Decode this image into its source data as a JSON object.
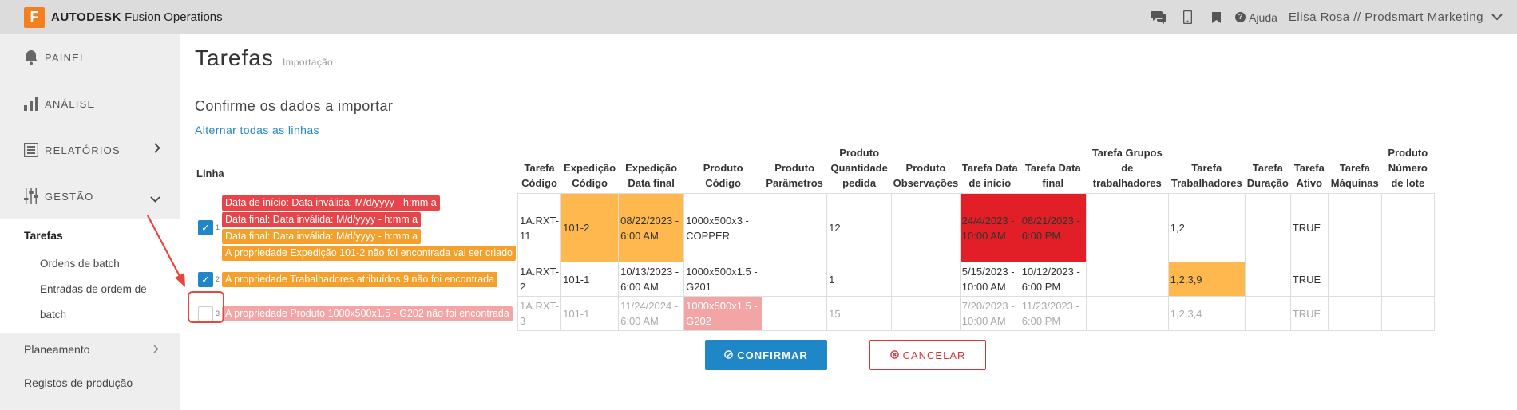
{
  "topbar": {
    "logo_letter": "F",
    "brand_bold": "AUTODESK",
    "brand_rest": "Fusion Operations",
    "help_label": "Ajuda",
    "user_label": "Elisa Rosa // Prodsmart Marketing",
    "icons": [
      "chat-icon",
      "mobile-icon",
      "bookmark-icon",
      "question-icon",
      "chevron-down-icon"
    ]
  },
  "sidebar": {
    "painel": "PAINEL",
    "analise": "ANÁLISE",
    "relatorios": "RELATÓRIOS",
    "gestao": "GESTÃO",
    "tarefas": "Tarefas",
    "ordens": "Ordens de batch",
    "entradas": "Entradas de ordem de batch",
    "planeamento": "Planeamento",
    "registos": "Registos de produção"
  },
  "page": {
    "title": "Tarefas",
    "subtitle": "Importação",
    "confirm_heading": "Confirme os dados a importar",
    "toggle_all": "Alternar todas as linhas"
  },
  "table": {
    "headers": {
      "linha": "Linha",
      "h1": "Tarefa Código",
      "h2": "Expedição Código",
      "h3": "Expedição Data final",
      "h4": "Produto Código",
      "h5": "Produto Parâmetros",
      "h6": "Produto Quantidade pedida",
      "h7": "Produto Observações",
      "h8": "Tarefa Data de início",
      "h9": "Tarefa Data final",
      "h10": "Tarefa Grupos de trabalhadores",
      "h11": "Tarefa Trabalhadores",
      "h12": "Tarefa Duração",
      "h13": "Tarefa Ativo",
      "h14": "Tarefa Máquinas",
      "h15": "Produto Número de lote"
    },
    "rows": [
      {
        "num": "1",
        "checked": true,
        "errors": [
          "Data de início: Data inválida: M/d/yyyy - h:mm a",
          "Data final: Data inválida: M/d/yyyy - h:mm a",
          "Data final: Data inválida: M/d/yyyy - h:mm a",
          "A propriedade Expedição 101-2 não foi encontrada vai ser criado"
        ],
        "c1": "1A.RXT-11",
        "c2": "101-2",
        "c3": "08/22/2023 - 6:00 AM",
        "c4": "1000x500x3 - COPPER",
        "c5": "",
        "c6": "12",
        "c7": "",
        "c8": "24/4/2023 - 10:00 AM",
        "c9": "08/21/2023 - 6:00 PM",
        "c10": "",
        "c11": "1,2",
        "c12": "",
        "c13": "TRUE",
        "c14": "",
        "c15": ""
      },
      {
        "num": "2",
        "checked": true,
        "errors": [
          "A propriedade Trabalhadores atribuídos 9 não foi encontrada"
        ],
        "c1": "1A.RXT-2",
        "c2": "101-1",
        "c3": "10/13/2023 - 6:00 AM",
        "c4": "1000x500x1.5 - G201",
        "c5": "",
        "c6": "1",
        "c7": "",
        "c8": "5/15/2023 - 10:00 AM",
        "c9": "10/12/2023 - 6:00 PM",
        "c10": "",
        "c11": "1,2,3,9",
        "c12": "",
        "c13": "TRUE",
        "c14": "",
        "c15": ""
      },
      {
        "num": "3",
        "checked": false,
        "errors": [
          "A propriedade Produto 1000x500x1.5 - G202 não foi encontrada"
        ],
        "c1": "1A.RXT-3",
        "c2": "101-1",
        "c3": "11/24/2024 - 6:00 AM",
        "c4": "1000x500x1.5 - G202",
        "c5": "",
        "c6": "15",
        "c7": "",
        "c8": "7/20/2023 - 10:00 AM",
        "c9": "11/23/2023 - 6:00 PM",
        "c10": "",
        "c11": "1,2,3,4",
        "c12": "",
        "c13": "TRUE",
        "c14": "",
        "c15": ""
      }
    ]
  },
  "buttons": {
    "confirm": "CONFIRMAR",
    "cancel": "CANCELAR"
  },
  "colors": {
    "accent": "#1f86c8",
    "warning": "#ffb84d",
    "error": "#e21f26",
    "error_light": "#f3a5a5",
    "brand": "#f47f20"
  }
}
